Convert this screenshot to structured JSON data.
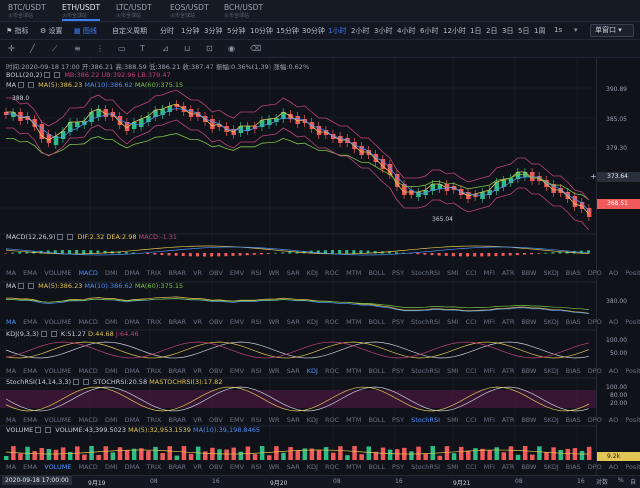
{
  "tabs": [
    {
      "pair": "BTC/USDT",
      "sub": "火币全球站"
    },
    {
      "pair": "ETH/USDT",
      "sub": "火币全球站"
    },
    {
      "pair": "LTC/USDT",
      "sub": "火币全球站"
    },
    {
      "pair": "EOS/USDT",
      "sub": "火币全球站"
    },
    {
      "pair": "BCH/USDT",
      "sub": "火币全球站"
    }
  ],
  "toolbar": {
    "indicator": "指标",
    "settings": "设置",
    "chart": "图线",
    "custom_period": "自定义周期",
    "periods": [
      "分时",
      "1分钟",
      "3分钟",
      "5分钟",
      "10分钟",
      "15分钟",
      "30分钟",
      "1小时",
      "2小时",
      "3小时",
      "4小时",
      "6小时",
      "12小时",
      "1日",
      "2日",
      "3日",
      "5日",
      "1周",
      "1s"
    ],
    "active_period": "1小时",
    "view": "单窗口"
  },
  "info": {
    "text": "时间:2020-09-18 17:00 开:386.21 高:388.59 低:386.21 收:387.47 振幅:0.36%(1.39) 涨幅:0.62%",
    "boll": "BOLL(20,2)",
    "boll_vals": "MB:386.22 UB:392.96 LB:379.47",
    "ma": "MA",
    "ma5": "MA(5):386.23",
    "ma10": "MA(10):386.62",
    "ma60": "MA(60):375.15"
  },
  "price_axis": [
    "390.89",
    "385.05",
    "379.30",
    "373.64",
    "368.51"
  ],
  "current_price": "368.51",
  "cursor_price": "373.64",
  "hi_label": "388.0",
  "lo_label": "365.04",
  "indicators": [
    "MA",
    "EMA",
    "VOLUME",
    "MACD",
    "DMI",
    "DMA",
    "TRIX",
    "BRAR",
    "VR",
    "OBV",
    "EMV",
    "RSI",
    "WR",
    "SAR",
    "KDJ",
    "ROC",
    "MTM",
    "BOLL",
    "PSY",
    "StochRSI",
    "SMI",
    "CCI",
    "MFI",
    "ATR",
    "BBW",
    "SKDJ",
    "BIAS",
    "DPO",
    "AO",
    "Position"
  ],
  "macd": {
    "name": "MACD(12,26,9)",
    "dif": "DIF:2.32",
    "dea": "DEA:2.98",
    "macd": "MACD:-1.31"
  },
  "ma2": {
    "name": "MA",
    "ma5": "MA(5):386.23",
    "ma10": "MA(10):386.62",
    "ma60": "MA(60):375.15",
    "axis": "380.00"
  },
  "kdj": {
    "name": "KDJ(9,3,3)",
    "k": "K:51.27",
    "d": "D:44.68",
    "j": "J:64.46",
    "axis": [
      "100.00",
      "50.00",
      "0.00"
    ]
  },
  "stoch": {
    "name": "StochRSI(14,14,3,3)",
    "val": "STOCHRSI:20.58",
    "sig": "MASTOCHRSI(3):17.82",
    "axis": [
      "100.00",
      "80.00",
      "20.00",
      "0.00"
    ]
  },
  "volume": {
    "name": "VOLUME",
    "v": "VOLUME:43,399.5023",
    "ma5": "MA(5):32,953.1539",
    "ma10": "MA(10):39,198.8465",
    "axis": "9.2k"
  },
  "time_axis": {
    "cursor": "2020-09-18 17:00:00",
    "labels": [
      "9月19",
      "08",
      "16",
      "9月20",
      "08",
      "16",
      "9月21",
      "08",
      "16"
    ]
  },
  "colors": {
    "up": "#2fbd85",
    "down": "#f05a5a",
    "accent": "#3d7ef5",
    "ma5": "#e3c555",
    "ma10": "#4d8ef0",
    "ma60": "#7bc244",
    "boll": "#c0437b"
  }
}
